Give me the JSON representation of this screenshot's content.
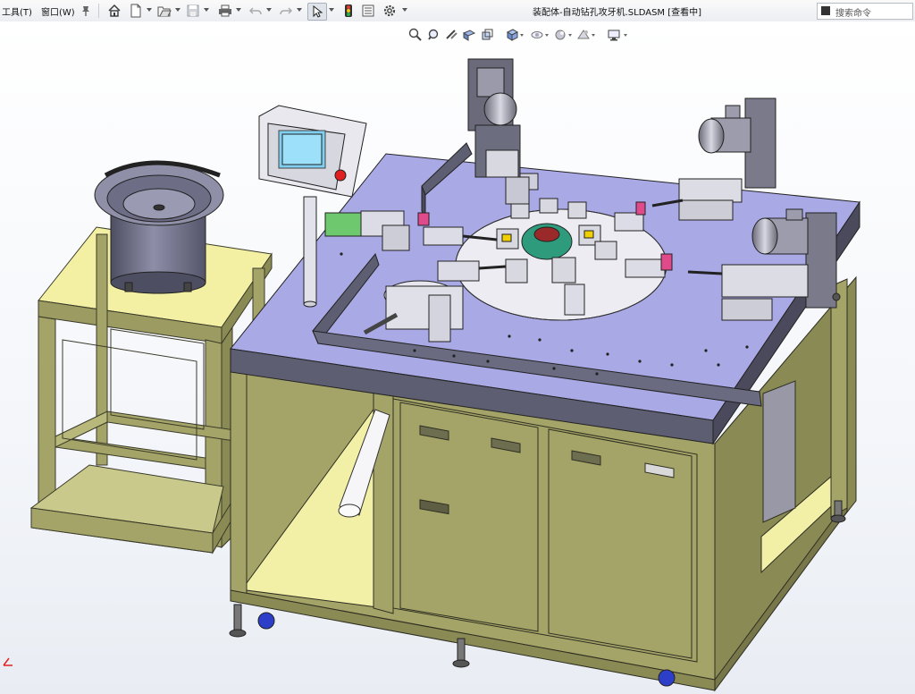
{
  "menubar": {
    "tools_label": "工具(T)",
    "window_label": "窗口(W)"
  },
  "toolbar": {
    "buttons": [
      "pin-icon",
      "home-icon",
      "new-document-icon",
      "open-icon",
      "save-icon",
      "print-icon",
      "undo-icon",
      "redo-icon",
      "select-icon",
      "rebuild-icon",
      "file-properties-icon",
      "options-icon"
    ]
  },
  "document": {
    "title": "装配体-自动钻孔攻牙机.SLDASM [查看中]"
  },
  "search": {
    "placeholder": "搜索命令"
  },
  "view_toolbar": {
    "buttons": [
      "zoom-to-fit-icon",
      "zoom-to-area-icon",
      "previous-view-icon",
      "section-view-icon",
      "view-orientation-icon",
      "display-style-icon",
      "hide-show-items-icon",
      "edit-appearance-icon",
      "apply-scene-icon",
      "view-settings-icon"
    ]
  },
  "colors": {
    "table_top": "#a9a9e6",
    "frame_olive": "#a4a468",
    "frame_yellow": "#f2efa6",
    "dark_housing": "#5e5e72"
  }
}
